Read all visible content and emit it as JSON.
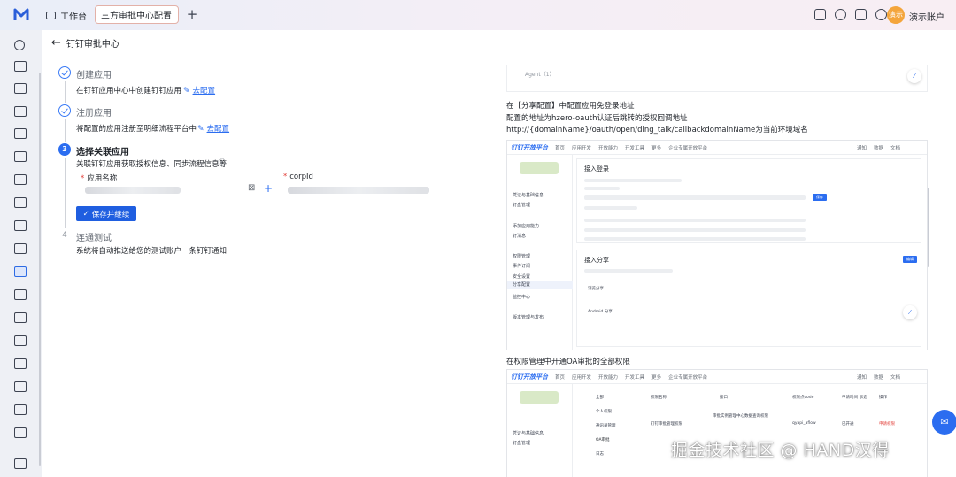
{
  "topbar": {
    "home_tab": "工作台",
    "active_tab": "三方审批中心配置",
    "add_tab": "+",
    "account_name": "演示账户",
    "avatar_text": "演示"
  },
  "page": {
    "back_title": "钉钉审批中心"
  },
  "steps": [
    {
      "title": "创建应用",
      "desc": "在钉钉应用中心中创建钉钉应用",
      "link": "去配置",
      "state": "done"
    },
    {
      "title": "注册应用",
      "desc": "将配置的应用注册至明细流程平台中",
      "link": "去配置",
      "state": "done"
    },
    {
      "number": "3",
      "title": "选择关联应用",
      "desc": "关联钉钉应用获取授权信息、同步流程信息等",
      "state": "current"
    },
    {
      "number": "4",
      "title": "连通测试",
      "desc": "系统将自动推送给您的测试账户一条钉钉通知",
      "state": "pending"
    }
  ],
  "form": {
    "app_name_label": "应用名称",
    "corpid_label": "corpId",
    "save_button": "保存并继续"
  },
  "doc": {
    "agentid_caption": "Agent（1）",
    "section1_heading": "在【分享配置】中配置应用免登录地址",
    "section1_text": "配置的地址为hzero-oauth认证后跳转的授权回调地址http://{domainName}/oauth/open/ding_talk/callbackdomainName为当前环境域名",
    "section2_heading": "在权限管理中开通OA审批的全部权限",
    "shot1": {
      "brand": "钉钉开放平台",
      "nav": [
        "首页",
        "应用开发",
        "开放能力",
        "开发工具",
        "更多",
        "企业专属开放平台"
      ],
      "nav_right": [
        "通知",
        "数据",
        "文档"
      ],
      "panel_title_1": "接入登录",
      "panel_title_2": "接入分享",
      "side_items": [
        "凭证与基础信息",
        "钉盘管理",
        "添加应用能力",
        "钉消息",
        "权限管理",
        "事件订阅",
        "安全设置",
        "分享配置",
        "监控中心",
        "版本管理与发布"
      ],
      "row1": "浏览分享",
      "row2": "Android 分享",
      "save_btn": "保存",
      "edit_btn": "编辑"
    },
    "shot2": {
      "brand": "钉钉开放平台",
      "nav": [
        "首页",
        "应用开发",
        "开放能力",
        "开发工具",
        "更多",
        "企业专属开放平台"
      ],
      "nav_right": [
        "通知",
        "数据",
        "文档"
      ],
      "side_items": [
        "凭证与基础信息",
        "钉盘管理"
      ],
      "col_headers": [
        "权限名称",
        "接口",
        "权限点code",
        "申请时间",
        "状态",
        "操作"
      ],
      "left_col": [
        "全部",
        "个人权限",
        "通讯录管理",
        "OA审批",
        "日志"
      ],
      "cells": [
        "审批实例管理中心数据查询权限",
        "钉钉审批管理权限",
        "qyapi_aflow",
        "已开通",
        "申请权限"
      ]
    }
  },
  "watermark": "掘金技术社区 @ HAND汉得"
}
